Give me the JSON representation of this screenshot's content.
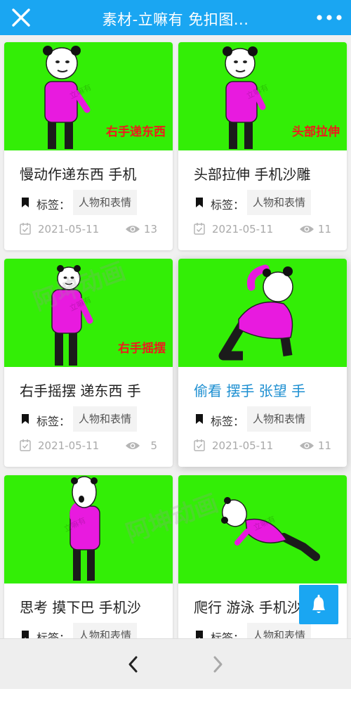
{
  "header": {
    "title": "素材-立嘛有 免扣图...",
    "close_icon": "close-icon",
    "more_icon": "more-dots-icon",
    "bg_color": "#1aa6f2"
  },
  "watermarks": [
    "阿坤动画",
    "阿坤动画",
    "立嘛有"
  ],
  "cards": [
    {
      "overlay_text": "右手递东西",
      "title": "慢动作递东西 手机",
      "tag_label": "标签：",
      "tag": "人物和表情",
      "date": "2021-05-11",
      "views": "13"
    },
    {
      "overlay_text": "头部拉伸",
      "title": "头部拉伸 手机沙雕",
      "tag_label": "标签：",
      "tag": "人物和表情",
      "date": "2021-05-11",
      "views": "11"
    },
    {
      "overlay_text": "右手摇摆",
      "title": "右手摇摆 递东西 手",
      "tag_label": "标签：",
      "tag": "人物和表情",
      "date": "2021-05-11",
      "views": "5"
    },
    {
      "overlay_text": "",
      "title": "偷看 摆手 张望 手",
      "tag_label": "标签：",
      "tag": "人物和表情",
      "date": "2021-05-11",
      "views": "11"
    },
    {
      "overlay_text": "",
      "title": "思考 摸下巴 手机沙",
      "tag_label": "标签：",
      "tag": "人物和表情",
      "date": "",
      "views": ""
    },
    {
      "overlay_text": "",
      "title": "爬行 游泳 手机沙雕",
      "tag_label": "标签：",
      "tag": "人物和表情",
      "date": "",
      "views": ""
    }
  ],
  "fab_icon": "bell-icon",
  "nav": {
    "back_icon": "chevron-left-icon",
    "forward_icon": "chevron-right-icon"
  },
  "colors": {
    "thumb_bg": "#33ee06",
    "character_shirt": "#e81adf",
    "overlay_text": "#ee1c1c",
    "highlight_title": "#1d8fd1"
  }
}
